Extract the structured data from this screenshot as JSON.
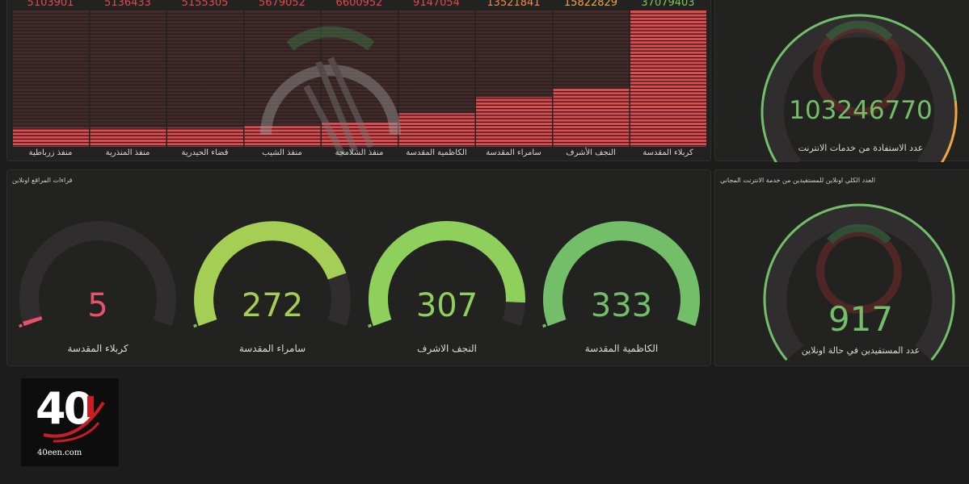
{
  "bar_panel": {
    "values": [
      "5103901",
      "5136433",
      "5155305",
      "5679052",
      "6600952",
      "9147054",
      "13521841",
      "15822829",
      "37079403"
    ],
    "categories": [
      "منفذ زرباطية",
      "منفذ المنذرية",
      "قضاء الحيدرية",
      "منفذ الشيب",
      "منفذ الشلامجة",
      "الكاظمية المقدسة",
      "سامراء المقدسة",
      "النجف الأشرف",
      "كربلاء المقدسة"
    ],
    "value_colors": [
      "#e5484d",
      "#e5484d",
      "#e5484d",
      "#e5484d",
      "#e5484d",
      "#e5484d",
      "#f08a4b",
      "#f2a640",
      "#7dc45a"
    ]
  },
  "chart_data": {
    "type": "bar",
    "categories": [
      "منفذ زرباطية",
      "منفذ المنذرية",
      "قضاء الحيدرية",
      "منفذ الشيب",
      "منفذ الشلامجة",
      "الكاظمية المقدسة",
      "سامراء المقدسة",
      "النجف الأشرف",
      "كربلاء المقدسة"
    ],
    "values": [
      5103901,
      5136433,
      5155305,
      5679052,
      6600952,
      9147054,
      13521841,
      15822829,
      37079403
    ],
    "ylim": [
      0,
      37079403
    ]
  },
  "total_gauge": {
    "value": "103246770",
    "label": "عدد الاستفادة من خدمات الانترنت",
    "fill_fraction": 0.82
  },
  "readings_panel": {
    "title": "قراءات المراقع اونلاين",
    "gauges": [
      {
        "value": "5",
        "label": "كربلاء المقدسة",
        "color": "#e8516a",
        "fraction": 0.015
      },
      {
        "value": "272",
        "label": "سامراء المقدسة",
        "color": "#a4cf54",
        "fraction": 0.82
      },
      {
        "value": "307",
        "label": "النجف الاشرف",
        "color": "#8fcf5c",
        "fraction": 0.92
      },
      {
        "value": "333",
        "label": "الكاظمية المقدسة",
        "color": "#73bf69",
        "fraction": 1.0
      }
    ]
  },
  "online_panel": {
    "title": "العدد الكلي اونلاين للمستفيدين من خدمة الانترنت المجاني",
    "value": "917",
    "label": "عدد المستفيدين في حالة اونلاين"
  },
  "logo": {
    "number": "40",
    "site": "40een.com"
  },
  "colors": {
    "green": "#73bf69",
    "red": "#e5484d",
    "orange": "#f2a640"
  }
}
